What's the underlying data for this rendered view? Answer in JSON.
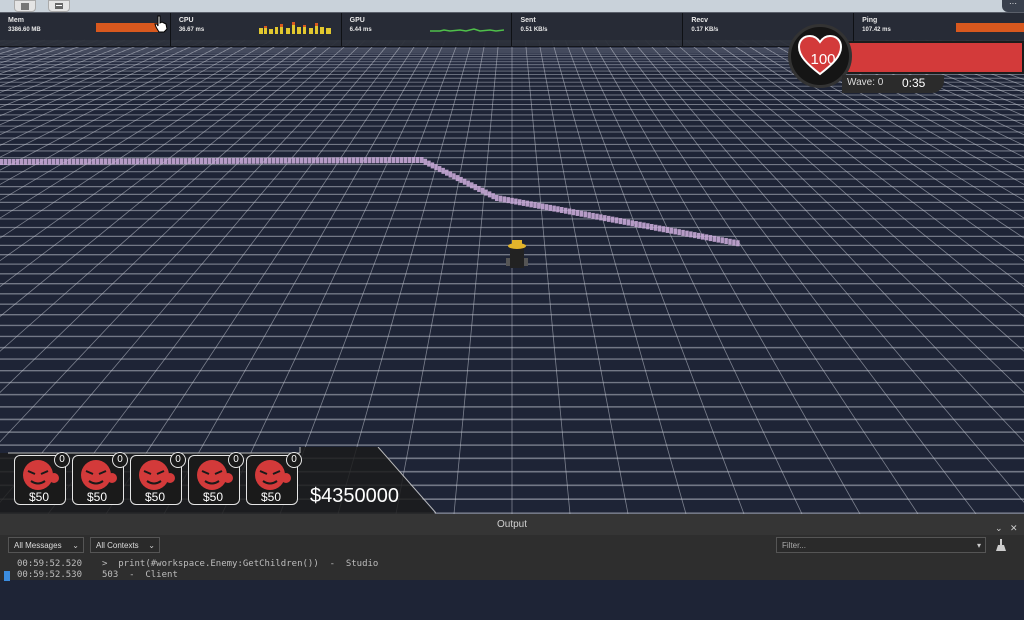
{
  "stats": [
    {
      "label": "Mem",
      "value": "3386.60 MB"
    },
    {
      "label": "CPU",
      "value": "36.67 ms"
    },
    {
      "label": "GPU",
      "value": "6.44 ms"
    },
    {
      "label": "Sent",
      "value": "0.51 KB/s"
    },
    {
      "label": "Recv",
      "value": "0.17 KB/s"
    },
    {
      "label": "Ping",
      "value": "107.42 ms"
    }
  ],
  "hud": {
    "health": "100",
    "wave_label": "Wave: 0",
    "timer": "0:35"
  },
  "towers": [
    {
      "price": "$50",
      "count": "0"
    },
    {
      "price": "$50",
      "count": "0"
    },
    {
      "price": "$50",
      "count": "0"
    },
    {
      "price": "$50",
      "count": "0"
    },
    {
      "price": "$50",
      "count": "0"
    }
  ],
  "money": "$4350000",
  "output": {
    "title": "Output",
    "messages_filter": "All Messages",
    "contexts_filter": "All Contexts",
    "filter_placeholder": "Filter...",
    "lines": [
      {
        "time": "00:59:52.520",
        "text": ">  print(#workspace.Enemy:GetChildren())  -  Studio"
      },
      {
        "time": "00:59:52.530",
        "text": "503  -  Client"
      }
    ]
  },
  "colors": {
    "sky": "#1e2436",
    "grid_line": "#c8ccd6",
    "enemy_path": "#c7a9d6",
    "health_bar": "#d33a3a",
    "stat_bar": "#d8581e"
  }
}
